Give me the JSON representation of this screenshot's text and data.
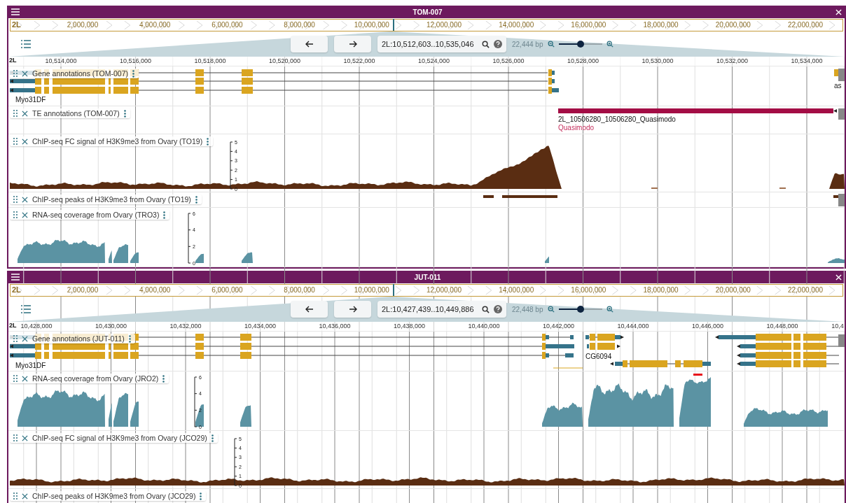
{
  "views": [
    {
      "title": "TOM-007",
      "overview": {
        "chromosome": "2L",
        "ticks": [
          "2,000,000",
          "4,000,000",
          "6,000,000",
          "8,000,000",
          "10,000,000",
          "12,000,000",
          "14,000,000",
          "16,000,000",
          "18,000,000",
          "20,000,000",
          "22,000,000"
        ]
      },
      "location": "2L:10,512,603..10,535,046",
      "span": "22,444 bp",
      "zoom": {
        "level": 0.5
      },
      "ruler": {
        "chromosome": "2L",
        "ticks": [
          "10,514,000",
          "10,516,000",
          "10,518,000",
          "10,520,000",
          "10,522,000",
          "10,524,000",
          "10,526,000",
          "10,528,000",
          "10,530,000",
          "10,532,000",
          "10,534,000"
        ]
      },
      "tracks": [
        {
          "kind": "genes",
          "name": "Gene annotations (TOM-007)",
          "features": [
            {
              "label": "Myo31DF"
            },
            {
              "label": "as"
            }
          ]
        },
        {
          "kind": "te",
          "name": "TE annotations (TOM-007)",
          "features": [
            {
              "label": "2L_10506280_10506280_Quasimodo",
              "description": "Quasimodo"
            }
          ]
        },
        {
          "kind": "signal",
          "name": "ChIP-seq FC signal of H3K9me3 from Ovary (TO19)",
          "axis_ticks": [
            "5",
            "4",
            "3",
            "2",
            "1",
            "0"
          ]
        },
        {
          "kind": "peaks",
          "name": "ChIP-seq peaks of H3K9me3 from Ovary (TO19)"
        },
        {
          "kind": "coverage",
          "name": "RNA-seq coverage from Ovary (TRO3)",
          "axis_ticks": [
            "6",
            "4",
            "2",
            "0"
          ]
        }
      ]
    },
    {
      "title": "JUT-011",
      "overview": {
        "chromosome": "2L",
        "ticks": [
          "2,000,000",
          "4,000,000",
          "6,000,000",
          "8,000,000",
          "10,000,000",
          "12,000,000",
          "14,000,000",
          "16,000,000",
          "18,000,000",
          "20,000,000",
          "22,000,000"
        ]
      },
      "location": "2L:10,427,439..10,449,886",
      "span": "22,448 bp",
      "zoom": {
        "level": 0.5
      },
      "ruler": {
        "chromosome": "2L",
        "ticks": [
          "10,428,000",
          "10,430,000",
          "10,432,000",
          "10,434,000",
          "10,436,000",
          "10,438,000",
          "10,440,000",
          "10,442,000",
          "10,444,000",
          "10,446,000",
          "10,448,000",
          "10,4"
        ]
      },
      "tracks": [
        {
          "kind": "genes",
          "name": "Gene annotations (JUT-011)",
          "features": [
            {
              "label": "Myo31DF"
            },
            {
              "label": "CG6094"
            }
          ]
        },
        {
          "kind": "coverage",
          "name": "RNA-seq coverage from Ovary (JRO2)",
          "axis_ticks": [
            "6",
            "4",
            "2",
            "0"
          ]
        },
        {
          "kind": "signal",
          "name": "ChIP-seq FC signal of H3K9me3 from Ovary (JCO29)",
          "axis_ticks": [
            "5",
            "4",
            "3",
            "2",
            "1",
            "0"
          ]
        },
        {
          "kind": "peaks",
          "name": "ChIP-seq peaks of H3K9me3 from Ovary (JCO29)"
        }
      ]
    }
  ]
}
